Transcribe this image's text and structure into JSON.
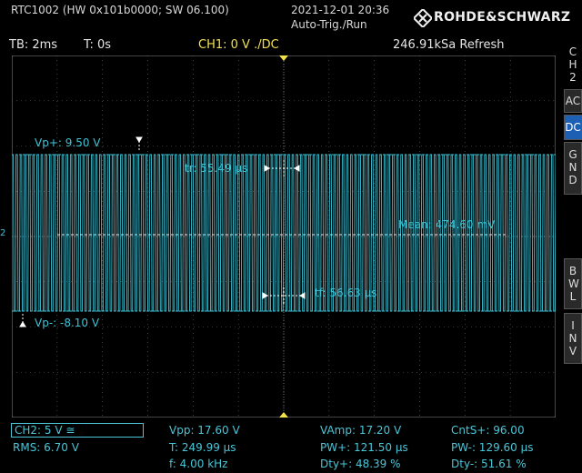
{
  "header": {
    "model": "RTC1002 (HW 0x101b0000; SW 06.100)",
    "datetime": "2021-12-01 20:36",
    "trigger_mode": "Auto-Trig./Run",
    "brand": "ROHDE&SCHWARZ"
  },
  "infobar": {
    "timebase": "TB: 2ms",
    "trigger_time": "T: 0s",
    "ch1_setting": "CH1: 0 V ./DC",
    "sample_rate": "246.91kSa Refresh"
  },
  "sidebar": {
    "channel": "CH2",
    "ac": "AC",
    "dc": "DC",
    "gnd": "GND",
    "bwl": "BWL",
    "inv": "INV"
  },
  "screen": {
    "vp_plus": "Vp+: 9.50 V",
    "vp_minus": "Vp-: -8.10 V",
    "rise_time": "tr: 55.49 µs",
    "fall_time": "tf: 56.63 µs",
    "mean": "Mean: 474.60 mV",
    "ch2_marker": "2"
  },
  "measurements": {
    "ch2_scale": "CH2: 5 V ≅",
    "rms": "RMS: 6.70 V",
    "vpp": "Vpp: 17.60 V",
    "period": "T: 249.99 µs",
    "freq": "f: 4.00 kHz",
    "vamp": "VAmp: 17.20 V",
    "pw_plus": "PW+: 121.50 µs",
    "dty_plus": "Dty+: 48.39 %",
    "cnt_s_plus": "CntS+: 96.00",
    "pw_minus": "PW-: 129.60 µs",
    "dty_minus": "Dty-: 51.61 %"
  },
  "colors": {
    "trace": "#3cc4d6",
    "grid": "#6a6a6a",
    "ch1": "#f2e24a",
    "active_button": "#1d5fb3"
  }
}
